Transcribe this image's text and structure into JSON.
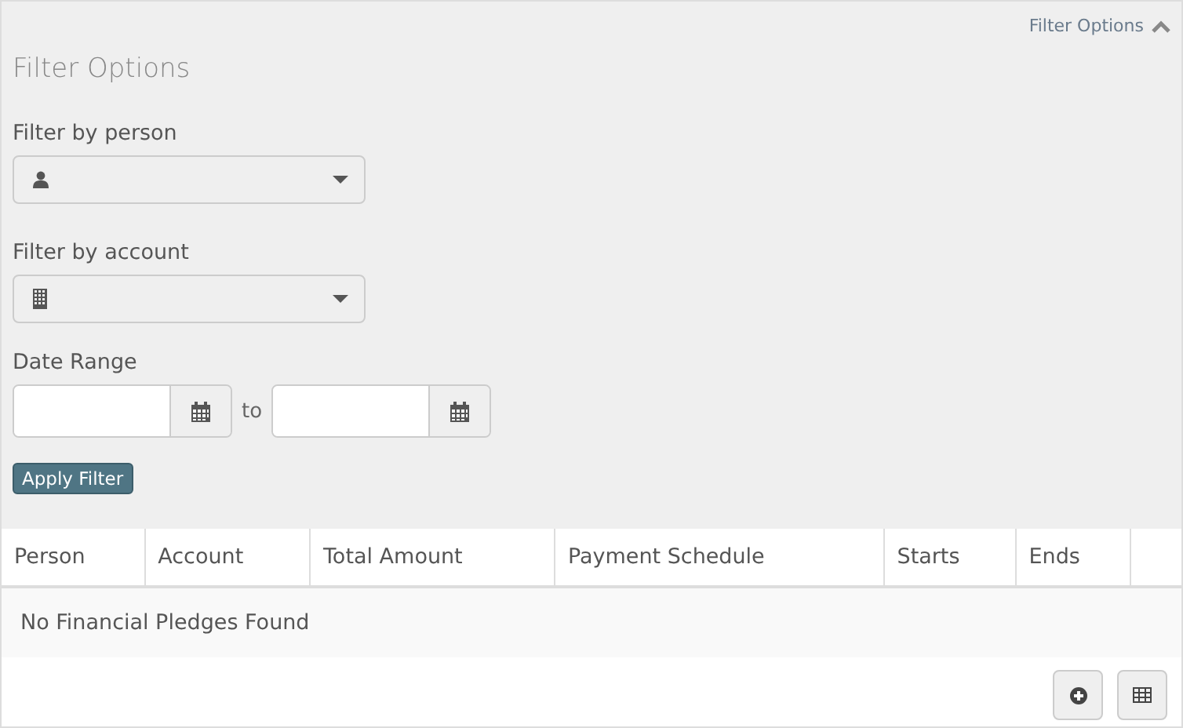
{
  "filter_toggle": {
    "label": "Filter Options",
    "expanded": true
  },
  "filter_panel": {
    "title": "Filter Options",
    "filters": [
      {
        "kind": "person",
        "label": "Filter by person"
      },
      {
        "kind": "account",
        "label": "Filter by account"
      }
    ],
    "date_range": {
      "label": "Date Range",
      "separator": "to"
    },
    "apply_button": "Apply Filter"
  },
  "table": {
    "columns": [
      "Person",
      "Account",
      "Total Amount",
      "Payment Schedule",
      "Starts",
      "Ends"
    ],
    "empty_message": "No Financial Pledges Found"
  }
}
